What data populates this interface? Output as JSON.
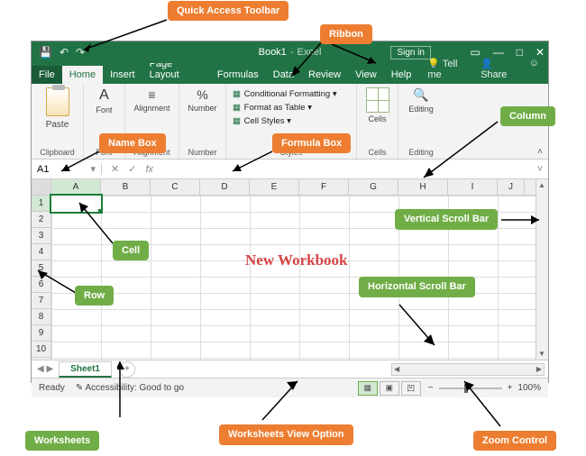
{
  "callouts": {
    "quick_access": "Quick Access Toolbar",
    "ribbon": "Ribbon",
    "name_box": "Name Box",
    "formula_box": "Formula Box",
    "column": "Column",
    "cell": "Cell",
    "row": "Row",
    "vscroll": "Vertical Scroll Bar",
    "hscroll": "Horizontal Scroll Bar",
    "worksheets": "Worksheets",
    "view_option": "Worksheets View Option",
    "zoom": "Zoom Control",
    "new_workbook": "New Workbook"
  },
  "title": {
    "book": "Book1",
    "app": "Excel",
    "signin": "Sign in"
  },
  "tabs": {
    "file": "File",
    "home": "Home",
    "insert": "Insert",
    "page_layout": "Page Layout",
    "formulas": "Formulas",
    "data": "Data",
    "review": "Review",
    "view": "View",
    "help": "Help",
    "tell_me": "Tell me",
    "share": "Share"
  },
  "ribbon": {
    "clipboard": {
      "paste": "Paste",
      "group": "Clipboard"
    },
    "font": {
      "label": "Font",
      "group": "Font"
    },
    "alignment": {
      "label": "Alignment",
      "group": "Alignment"
    },
    "number": {
      "label": "Number",
      "group": "Number"
    },
    "styles": {
      "cond": "Conditional Formatting",
      "table": "Format as Table",
      "cellstyles": "Cell Styles",
      "group": "Styles"
    },
    "cells": {
      "label": "Cells",
      "group": "Cells"
    },
    "editing": {
      "label": "Editing",
      "group": "Editing"
    }
  },
  "namebox_value": "A1",
  "fx_label": "fx",
  "columns": [
    "A",
    "B",
    "C",
    "D",
    "E",
    "F",
    "G",
    "H",
    "I",
    "J"
  ],
  "rows": [
    "1",
    "2",
    "3",
    "4",
    "5",
    "6",
    "7",
    "8",
    "9",
    "10"
  ],
  "sheet": {
    "name": "Sheet1"
  },
  "status": {
    "ready": "Ready",
    "accessibility": "Accessibility: Good to go",
    "zoom": "100%"
  }
}
